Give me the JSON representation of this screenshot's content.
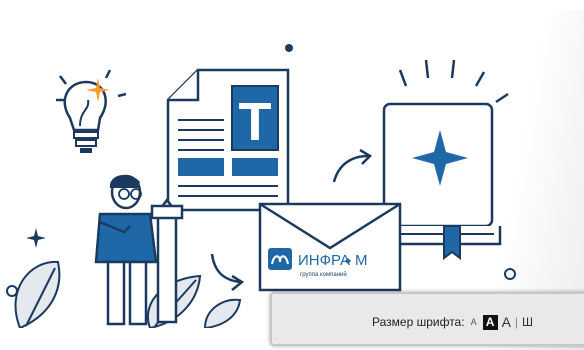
{
  "brand": {
    "name": "ИНФРА",
    "name_suffix": "М",
    "tagline": "группа компаний"
  },
  "document_icon": {
    "letter": "T"
  },
  "toolbar": {
    "font_size_label": "Размер шрифта:",
    "font_small": "A",
    "font_medium": "A",
    "font_large": "A",
    "separator": "|",
    "spacing_label": "Ш"
  },
  "colors": {
    "accent_blue": "#1f68a8",
    "outline": "#1b3a5e",
    "orange": "#ff9a2e",
    "leaf": "#e4e9ef",
    "toolbar_bg": "#e9e9e9"
  }
}
